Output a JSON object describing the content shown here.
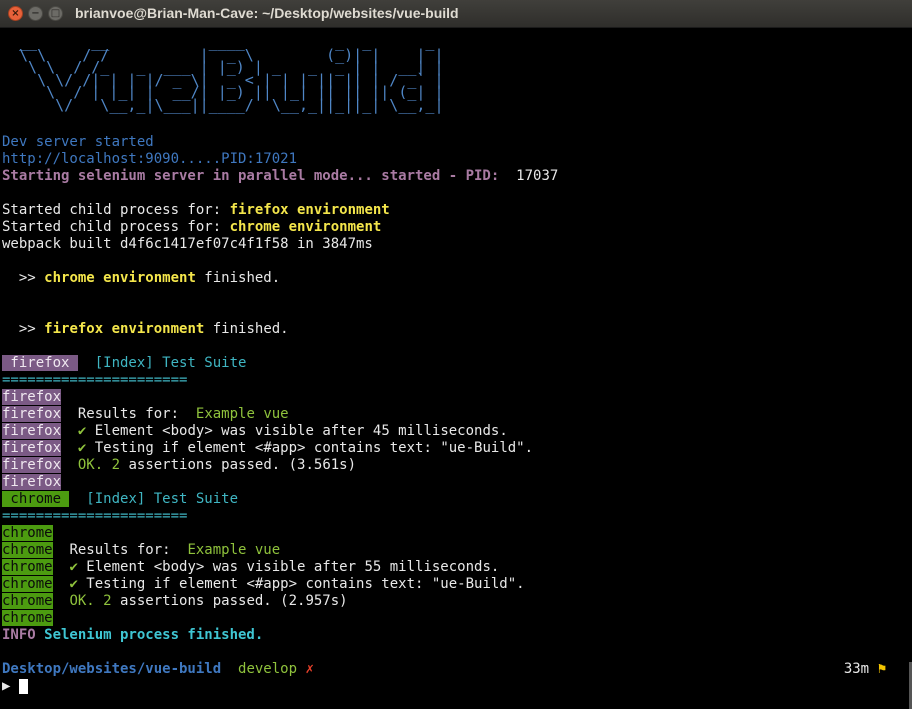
{
  "window": {
    "title": "brianvoe@Brian-Man-Cave: ~/Desktop/websites/vue-build",
    "close_glyph": "×",
    "min_glyph": "−",
    "max_glyph": "□"
  },
  "ascii_art": [
    " __      __           ____          _  _      _ ",
    " \\ \\    / /          |  _ \\        (_)| |    | |",
    "  \\ \\  / /_   _  ___ | |_) | _   _  _ | |  __| |",
    "   \\ \\/ /| | | |/ _ \\|  _ < | | | || || | / _` |",
    "    \\  / | |_| |  __/| |_) || |_| || || || (_| |",
    "     \\/   \\__,_|\\___||____/  \\__,_||_||_| \\__,_|"
  ],
  "log": {
    "dev_server": "Dev server started",
    "localhost": "http://localhost:9090.....PID:17021",
    "selenium": "Starting selenium server in parallel mode... started - PID:",
    "selenium_pid": "17037",
    "child_prefix": "Started child process for: ",
    "firefox_env": "firefox environment",
    "chrome_env": "chrome environment",
    "webpack": "webpack built d4f6c1417ef07c4f1f58 in 3847ms",
    "arrow": "  >> ",
    "finished": " finished."
  },
  "firefox_block": {
    "tag": " firefox ",
    "suite": "[Index] Test Suite",
    "separator": "======================",
    "gutter": [
      "firefox",
      "firefox",
      "firefox",
      "firefox",
      "firefox",
      "firefox"
    ],
    "results_label": "Results for:  ",
    "results_name": "Example vue",
    "check": "✔",
    "line1": " Element <body> was visible after 45 milliseconds.",
    "line2": " Testing if element <#app> contains text: \"ue-Build\".",
    "ok": "OK.",
    "count": " 2",
    "passed": " assertions passed. (3.561s)"
  },
  "chrome_block": {
    "tag": " chrome ",
    "suite": "[Index] Test Suite",
    "separator": "======================",
    "gutter": [
      "chrome",
      "chrome",
      "chrome",
      "chrome",
      "chrome",
      "chrome"
    ],
    "results_label": "Results for:  ",
    "results_name": "Example vue",
    "check": "✔",
    "line1": " Element <body> was visible after 55 milliseconds.",
    "line2": " Testing if element <#app> contains text: \"ue-Build\".",
    "ok": "OK.",
    "count": " 2",
    "passed": " assertions passed. (2.957s)"
  },
  "info": {
    "label": "INFO",
    "message": " Selenium process finished."
  },
  "prompt": {
    "path": "Desktop/websites/vue-build",
    "branch": "develop",
    "dirty": "✗",
    "elapsed": "33m",
    "flag": "⚑",
    "arrow": "▶"
  },
  "colors": {
    "background": "#000000",
    "ascii_blue": "#4f86c6",
    "firefox_bg": "#7b5a85",
    "chrome_bg": "#4c9b10",
    "env_yellow": "#f4e64b",
    "info_cyan": "#3fc6d3"
  }
}
